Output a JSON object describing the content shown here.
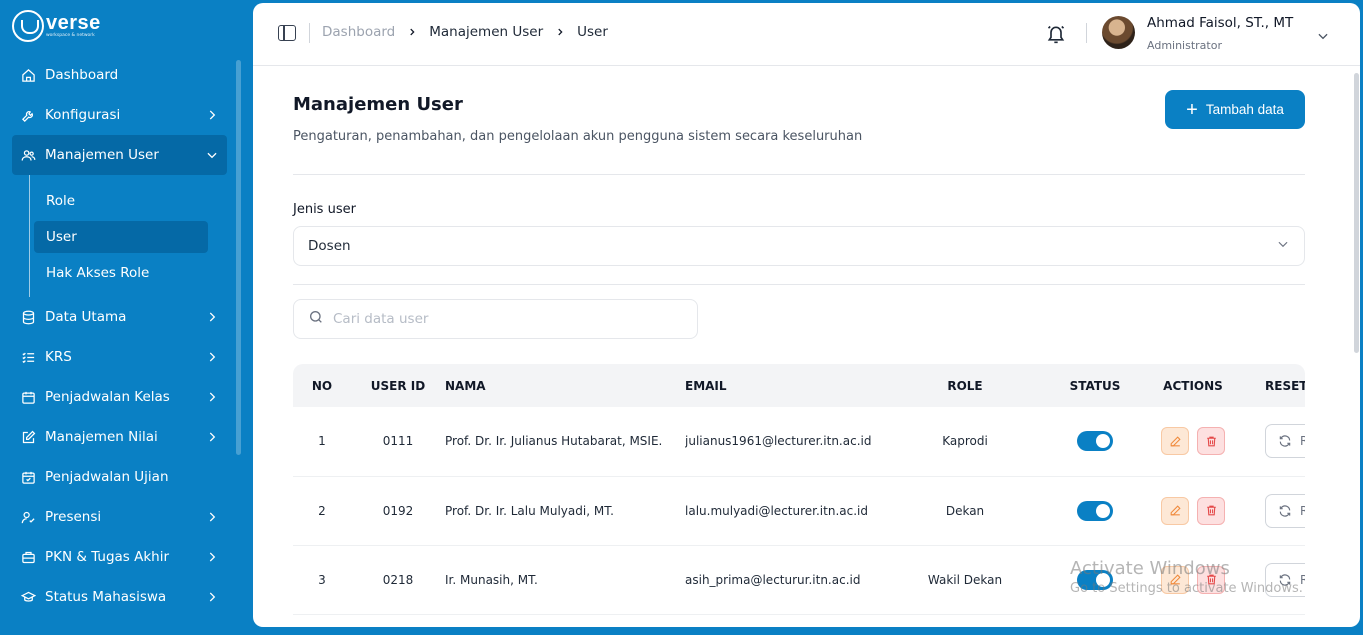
{
  "brand": {
    "word": "verse",
    "sub": "workspace & network"
  },
  "sidebar": {
    "items": [
      {
        "label": "Dashboard",
        "icon": "home-icon",
        "chevron": false
      },
      {
        "label": "Konfigurasi",
        "icon": "wrench-icon",
        "chevron": true
      },
      {
        "label": "Manajemen User",
        "icon": "users-icon",
        "chevron": true,
        "active": true
      },
      {
        "label": "Data Utama",
        "icon": "database-icon",
        "chevron": true
      },
      {
        "label": "KRS",
        "icon": "list-icon",
        "chevron": true
      },
      {
        "label": "Penjadwalan Kelas",
        "icon": "calendar-icon",
        "chevron": true
      },
      {
        "label": "Manajemen Nilai",
        "icon": "edit-icon",
        "chevron": true
      },
      {
        "label": "Penjadwalan Ujian",
        "icon": "calendar-check-icon",
        "chevron": false
      },
      {
        "label": "Presensi",
        "icon": "user-check-icon",
        "chevron": true
      },
      {
        "label": "PKN & Tugas Akhir",
        "icon": "briefcase-icon",
        "chevron": true
      },
      {
        "label": "Status Mahasiswa",
        "icon": "graduation-icon",
        "chevron": true
      }
    ],
    "submenu": [
      "Role",
      "User",
      "Hak Akses Role"
    ]
  },
  "breadcrumb": [
    "Dashboard",
    "Manajemen User",
    "User"
  ],
  "user": {
    "name": "Ahmad Faisol, ST., MT",
    "role": "Administrator"
  },
  "page": {
    "title": "Manajemen User",
    "description": "Pengaturan, penambahan, dan pengelolaan akun pengguna sistem secara keseluruhan",
    "add_button": "Tambah data",
    "filter_label": "Jenis user",
    "filter_value": "Dosen",
    "search_placeholder": "Cari data user"
  },
  "table": {
    "headers": [
      "NO",
      "USER ID",
      "NAMA",
      "EMAIL",
      "ROLE",
      "STATUS",
      "ACTIONS",
      "RESET PA"
    ],
    "reset_label": "R",
    "rows": [
      {
        "no": "1",
        "user_id": "0111",
        "nama": "Prof. Dr. Ir. Julianus Hutabarat, MSIE.",
        "email": "julianus1961@lecturer.itn.ac.id",
        "role": "Kaprodi"
      },
      {
        "no": "2",
        "user_id": "0192",
        "nama": "Prof. Dr. Ir. Lalu Mulyadi, MT.",
        "email": "lalu.mulyadi@lecturer.itn.ac.id",
        "role": "Dekan"
      },
      {
        "no": "3",
        "user_id": "0218",
        "nama": "Ir. Munasih, MT.",
        "email": "asih_prima@lecturur.itn.ac.id",
        "role": "Wakil Dekan"
      }
    ]
  },
  "watermark": {
    "line1": "Activate Windows",
    "line2": "Go to Settings to activate Windows."
  },
  "colors": {
    "primary": "#0a80c4",
    "active_nav": "#0569a6"
  }
}
